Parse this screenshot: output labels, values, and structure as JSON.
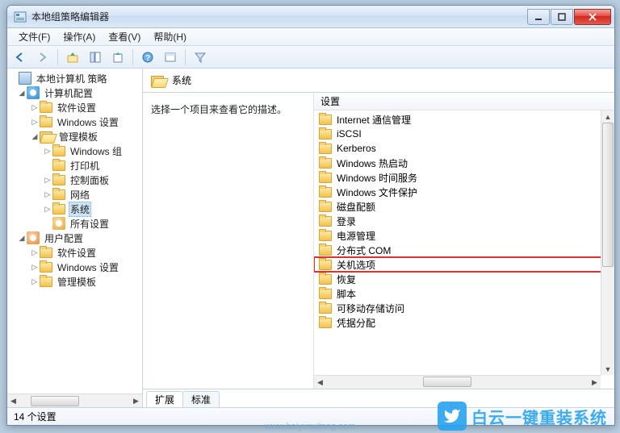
{
  "window": {
    "title": "本地组策略编辑器"
  },
  "menu": {
    "file": "文件(F)",
    "action": "操作(A)",
    "view": "查看(V)",
    "help": "帮助(H)"
  },
  "tree": {
    "root": "本地计算机 策略",
    "computer_config": "计算机配置",
    "software_settings": "软件设置",
    "software_settings2": "软件设置",
    "windows_settings": "Windows 设置",
    "windows_settings2": "Windows 设置",
    "admin_templates": "管理模板",
    "admin_templates2": "管理模板",
    "windows_components": "Windows 组",
    "printers": "打印机",
    "control_panel": "控制面板",
    "network": "网络",
    "system": "系统",
    "all_settings": "所有设置",
    "user_config": "用户配置"
  },
  "header": {
    "path": "系统"
  },
  "description": {
    "hint": "选择一个项目来查看它的描述。"
  },
  "list": {
    "column": "设置",
    "items": [
      "Internet 通信管理",
      "iSCSI",
      "Kerberos",
      "Windows 热启动",
      "Windows 时间服务",
      "Windows 文件保护",
      "磁盘配额",
      "登录",
      "电源管理",
      "分布式 COM",
      "关机选项",
      "恢复",
      "脚本",
      "可移动存储访问",
      "凭据分配"
    ],
    "highlight_index": 10
  },
  "tabs": {
    "extended": "扩展",
    "standard": "标准"
  },
  "status": {
    "count": "14 个设置"
  },
  "watermark": {
    "brand": "白云一键重装系统",
    "url": "www.baiyunxitong.com"
  }
}
